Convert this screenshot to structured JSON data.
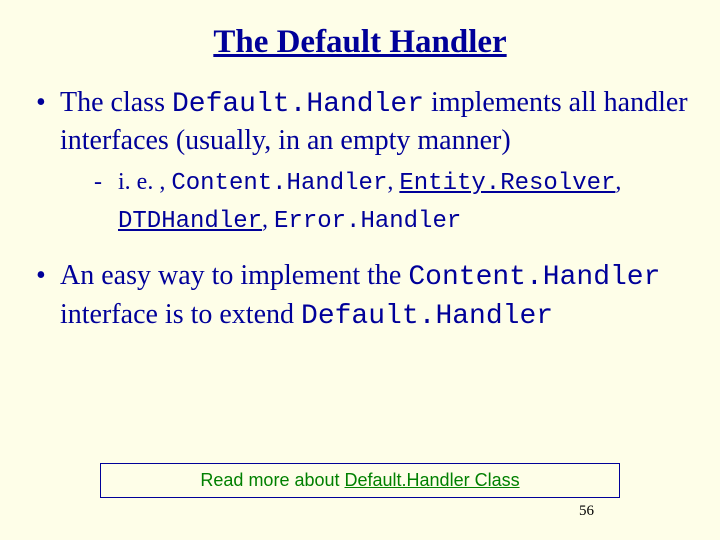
{
  "title": "The Default Handler",
  "bullet1": {
    "pre": "The class ",
    "code": "Default.Handler",
    "post": " implements all handler interfaces (usually, in an empty manner)"
  },
  "sub1": {
    "pre": "i. e. , ",
    "c1": "Content.Handler",
    "sep1": ", ",
    "c2": "Entity.Resolver",
    "sep2": ", ",
    "c3": "DTDHandler",
    "sep3": ", ",
    "c4": "Error.Handler"
  },
  "bullet2": {
    "pre": "An easy way to implement the ",
    "code1": "Content.Handler",
    "mid": " interface is to extend ",
    "code2": "Default.Handler"
  },
  "footer": {
    "pre": "Read more about ",
    "link": "Default.Handler Class"
  },
  "page_number": "56"
}
